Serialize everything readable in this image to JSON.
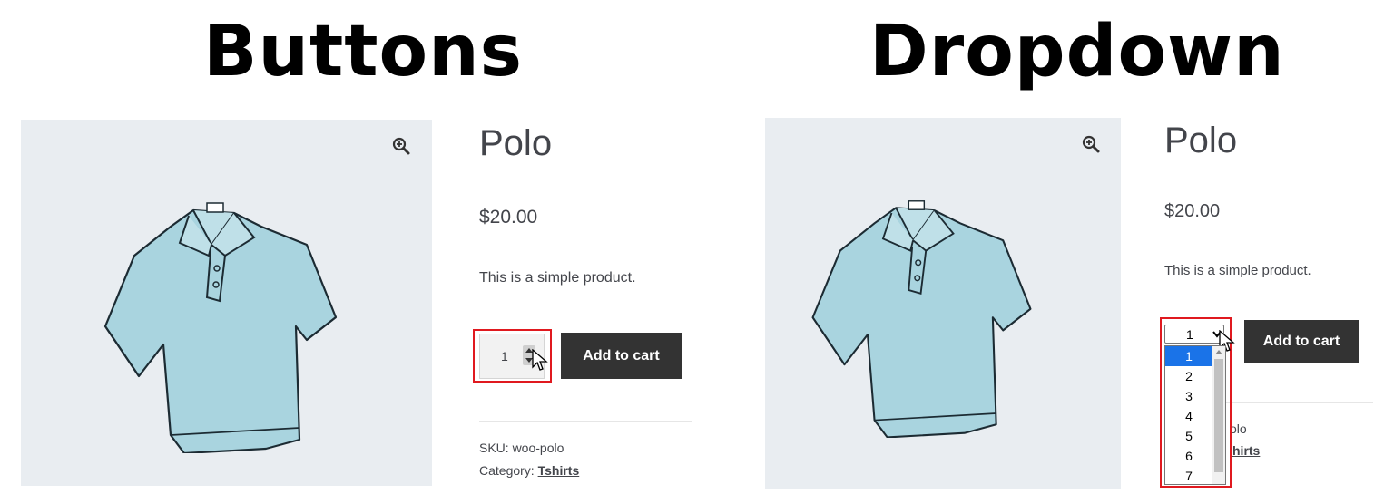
{
  "headings": {
    "left": "Buttons",
    "right": "Dropdown"
  },
  "product": {
    "title": "Polo",
    "price": "$20.00",
    "description": "This is a simple product.",
    "quantity": "1",
    "add_to_cart_label": "Add to cart",
    "sku_label": "SKU: woo-polo",
    "category_prefix": "Category: ",
    "category_link": "Tshirts",
    "sku_partial": "olo",
    "category_partial": "hirts"
  },
  "dropdown": {
    "selected": "1",
    "options": [
      "1",
      "2",
      "3",
      "4",
      "5",
      "6",
      "7"
    ]
  },
  "colors": {
    "highlight": "#e0191f",
    "button_bg": "#333333",
    "image_bg": "#e9edf1",
    "selected_option": "#1a73e8",
    "shirt": "#a9d4df"
  },
  "icons": [
    "zoom-in-icon",
    "spinner-arrows-icon",
    "mouse-cursor-icon",
    "chevron-down-icon",
    "shirt-illustration"
  ]
}
